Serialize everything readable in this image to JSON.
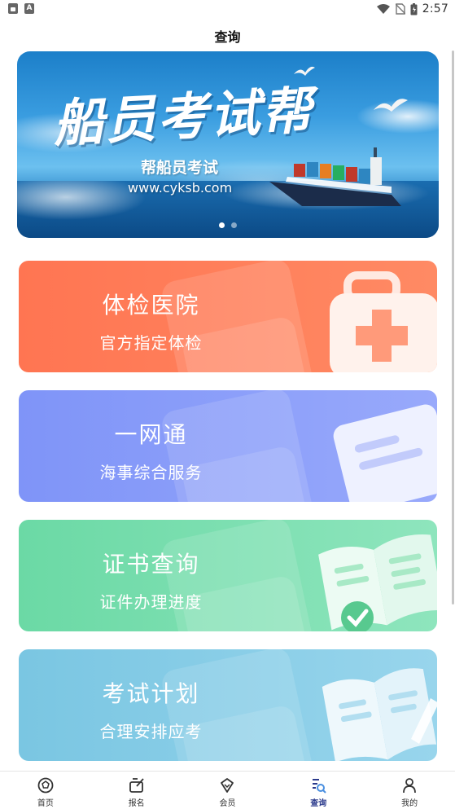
{
  "status_bar": {
    "time": "2:57",
    "left_icons": [
      "lock-icon",
      "font-a-icon"
    ],
    "right_icons": [
      "wifi-icon",
      "no-sim-icon",
      "battery-charging-icon"
    ]
  },
  "header": {
    "title": "查询"
  },
  "banner": {
    "title": "船员考试帮",
    "subtitle": "帮船员考试",
    "url": "www.cyksb.com",
    "dots": 2,
    "active_dot": 0
  },
  "cards": [
    {
      "title": "体检医院",
      "subtitle": "官方指定体检",
      "icon": "first-aid-kit-icon",
      "color": "#ff7a57"
    },
    {
      "title": "一网通",
      "subtitle": "海事综合服务",
      "icon": "document-icon",
      "color": "#8a9cf9"
    },
    {
      "title": "证书查询",
      "subtitle": "证件办理进度",
      "icon": "open-book-check-icon",
      "color": "#78dfae"
    },
    {
      "title": "考试计划",
      "subtitle": "合理安排应考",
      "icon": "book-pencil-icon",
      "color": "#86cde6"
    }
  ],
  "bottom_nav": {
    "items": [
      {
        "label": "首页",
        "icon": "home-ball-icon"
      },
      {
        "label": "报名",
        "icon": "signup-edit-icon"
      },
      {
        "label": "会员",
        "icon": "diamond-icon"
      },
      {
        "label": "查询",
        "icon": "search-list-icon"
      },
      {
        "label": "我的",
        "icon": "profile-icon"
      }
    ],
    "active_index": 3,
    "active_color": "#2b3a8c"
  }
}
